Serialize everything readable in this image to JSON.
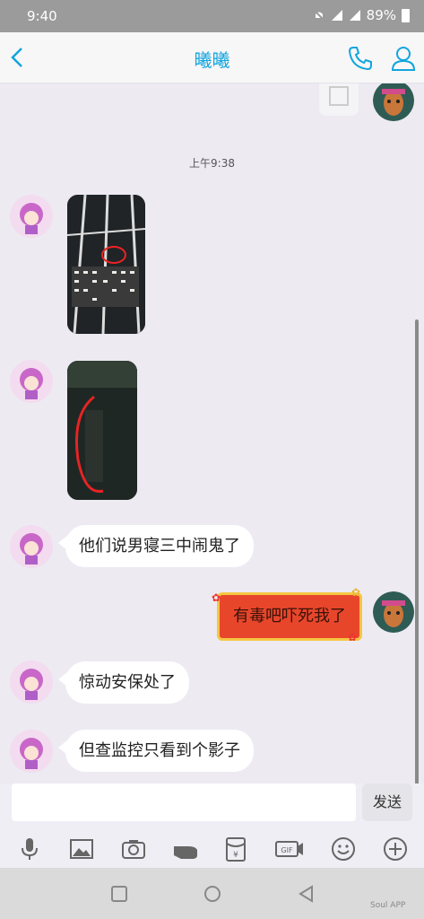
{
  "status_bar": {
    "time": "9:40",
    "battery": "89%"
  },
  "header": {
    "title": "曦曦"
  },
  "chat": {
    "timestamp": "上午9:38",
    "messages": [
      {
        "type": "image",
        "sender": "contact",
        "description": "dorm-window-photo"
      },
      {
        "type": "image",
        "sender": "contact",
        "description": "dark-hallway-photo"
      },
      {
        "type": "text",
        "sender": "contact",
        "text": "他们说男寝三中闹鬼了"
      },
      {
        "type": "text",
        "sender": "me",
        "text": "有毒吧吓死我了"
      },
      {
        "type": "text",
        "sender": "contact",
        "text": "惊动安保处了"
      },
      {
        "type": "text",
        "sender": "contact",
        "text": "但查监控只看到个影子"
      }
    ]
  },
  "composer": {
    "input_value": "",
    "send_label": "发送"
  },
  "toolbar": {
    "icons": [
      "microphone-icon",
      "image-icon",
      "camera-icon",
      "hand-icon",
      "red-packet-icon",
      "gif-icon",
      "emoji-icon",
      "plus-icon"
    ]
  },
  "watermark": "Soul APP",
  "colors": {
    "accent": "#12a5de",
    "bubble": "#ffffff",
    "background": "#edeaf2",
    "sticker": "#e8462b"
  }
}
